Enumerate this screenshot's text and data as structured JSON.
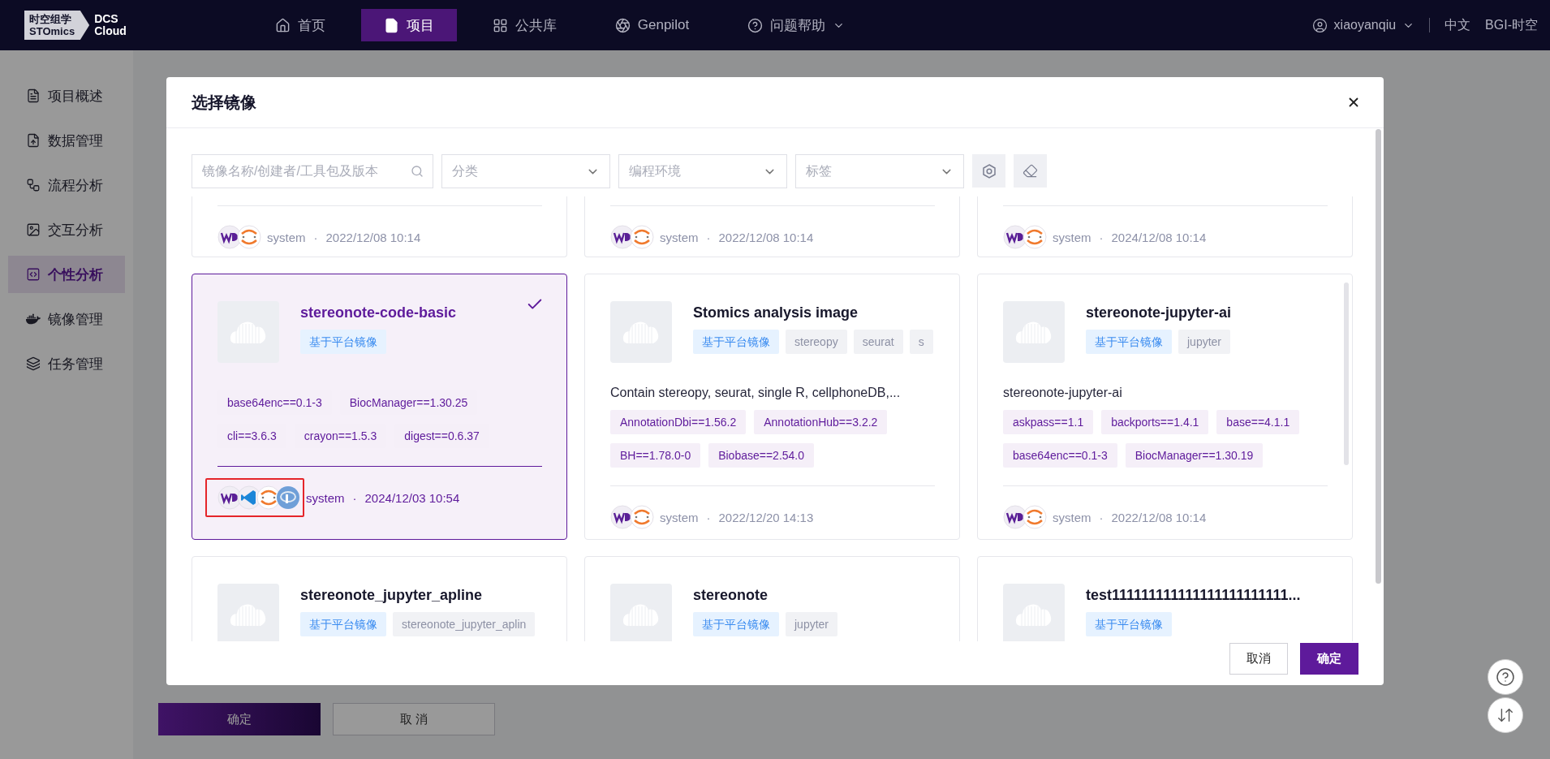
{
  "nav": {
    "logo": {
      "line_1": "时空组学",
      "line_2": "STOmics"
    },
    "product": {
      "line_1": "DCS",
      "line_2": "Cloud"
    },
    "items": [
      {
        "label": "首页",
        "kind": "home",
        "selected": false,
        "dropdown": false
      },
      {
        "label": "项目",
        "kind": "file",
        "selected": true,
        "dropdown": false
      },
      {
        "label": "公共库",
        "kind": "grid",
        "selected": false,
        "dropdown": false
      },
      {
        "label": "Genpilot",
        "kind": "aperture",
        "selected": false,
        "dropdown": false
      },
      {
        "label": "问题帮助",
        "kind": "help",
        "selected": false,
        "dropdown": true
      }
    ],
    "user": "xiaoyanqiu",
    "language": "中文",
    "organization": "BGI-时空"
  },
  "sidebar": {
    "items": [
      {
        "label": "项目概述",
        "kind": "doc",
        "selected": false
      },
      {
        "label": "数据管理",
        "kind": "upload",
        "selected": false
      },
      {
        "label": "流程分析",
        "kind": "flow",
        "selected": false
      },
      {
        "label": "交互分析",
        "kind": "image",
        "selected": false
      },
      {
        "label": "个性分析",
        "kind": "code",
        "selected": true
      },
      {
        "label": "镜像管理",
        "kind": "docker",
        "selected": false
      },
      {
        "label": "任务管理",
        "kind": "layers",
        "selected": false
      }
    ]
  },
  "page_buttons": [
    {
      "label": "确定",
      "kind": "primary"
    },
    {
      "label": "取 消",
      "kind": "default"
    }
  ],
  "dialog": {
    "title": "选择镜像",
    "search": {
      "placeholder": "镜像名称/创建者/工具包及版本"
    },
    "filters": [
      {
        "placeholder": "分类"
      },
      {
        "placeholder": "编程环境"
      },
      {
        "placeholder": "标签"
      }
    ],
    "rows": [
      {
        "kind": "tail",
        "cards": [
          {
            "author": "system",
            "separator": "·",
            "date": "2022/12/08 10:14",
            "envs": [
              {
                "kind": "wd"
              },
              {
                "kind": "jupyter"
              }
            ]
          },
          {
            "author": "system",
            "separator": "·",
            "date": "2022/12/08 10:14",
            "envs": [
              {
                "kind": "wd"
              },
              {
                "kind": "jupyter"
              }
            ]
          },
          {
            "author": "system",
            "separator": "·",
            "date": "2024/12/08 10:14",
            "envs": [
              {
                "kind": "wd"
              },
              {
                "kind": "jupyter"
              }
            ]
          }
        ]
      },
      {
        "kind": "full",
        "cards": [
          {
            "name": "stereonote-code-basic",
            "selected": true,
            "highlighted": true,
            "tags": [
              {
                "label": "基于平台镜像",
                "kind": "platform"
              }
            ],
            "packages": [
              "base64enc==0.1-3",
              "BiocManager==1.30.25",
              "cli==3.6.3",
              "crayon==1.5.3",
              "digest==0.6.37"
            ],
            "author": "system",
            "separator": "·",
            "date": "2024/12/03 10:54",
            "envs": [
              {
                "kind": "wd"
              },
              {
                "kind": "vscode"
              },
              {
                "kind": "jupyter"
              },
              {
                "kind": "r"
              }
            ]
          },
          {
            "name": "Stomics analysis image",
            "selected": false,
            "highlighted": false,
            "tags": [
              {
                "label": "基于平台镜像",
                "kind": "platform"
              },
              {
                "label": "stereopy",
                "kind": "plain"
              },
              {
                "label": "seurat",
                "kind": "plain"
              },
              {
                "label": "s",
                "kind": "plain"
              }
            ],
            "description": "Contain stereopy, seurat, single R, cellphoneDB,...",
            "packages": [
              "AnnotationDbi==1.56.2",
              "AnnotationHub==3.2.2",
              "BH==1.78.0-0",
              "Biobase==2.54.0"
            ],
            "author": "system",
            "separator": "·",
            "date": "2022/12/20 14:13",
            "envs": [
              {
                "kind": "wd"
              },
              {
                "kind": "jupyter"
              }
            ]
          },
          {
            "name": "stereonote-jupyter-ai",
            "selected": false,
            "highlighted": false,
            "tags": [
              {
                "label": "基于平台镜像",
                "kind": "platform"
              },
              {
                "label": "jupyter",
                "kind": "plain"
              }
            ],
            "description": "stereonote-jupyter-ai",
            "packages": [
              "askpass==1.1",
              "backports==1.4.1",
              "base==4.1.1",
              "base64enc==0.1-3",
              "BiocManager==1.30.19"
            ],
            "author": "system",
            "separator": "·",
            "date": "2022/12/08 10:14",
            "envs": [
              {
                "kind": "wd"
              },
              {
                "kind": "jupyter"
              }
            ]
          }
        ]
      },
      {
        "kind": "head",
        "cards": [
          {
            "name": "stereonote_jupyter_apline",
            "tags": [
              {
                "label": "基于平台镜像",
                "kind": "platform"
              },
              {
                "label": "stereonote_jupyter_aplin",
                "kind": "plain"
              }
            ]
          },
          {
            "name": "stereonote",
            "tags": [
              {
                "label": "基于平台镜像",
                "kind": "platform"
              },
              {
                "label": "jupyter",
                "kind": "plain"
              }
            ]
          },
          {
            "name": "test111111111111111111111111...",
            "tags": [
              {
                "label": "基于平台镜像",
                "kind": "platform"
              }
            ]
          }
        ]
      }
    ],
    "buttons": [
      {
        "label": "取消",
        "kind": "default"
      },
      {
        "label": "确定",
        "kind": "primary"
      }
    ]
  }
}
